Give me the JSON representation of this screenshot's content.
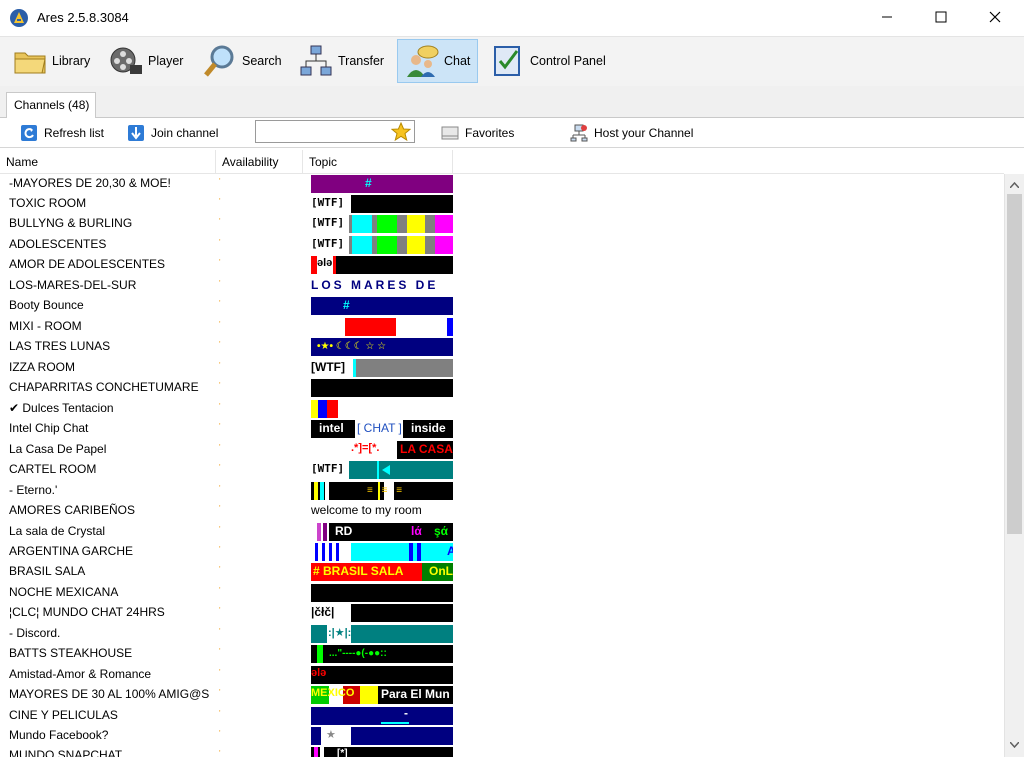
{
  "window": {
    "title": "Ares 2.5.8.3084"
  },
  "toolbar": {
    "items": [
      {
        "label": "Library",
        "icon": "folder-icon"
      },
      {
        "label": "Player",
        "icon": "film-reel-icon"
      },
      {
        "label": "Search",
        "icon": "magnifier-icon"
      },
      {
        "label": "Transfer",
        "icon": "network-transfer-icon"
      },
      {
        "label": "Chat",
        "icon": "chat-users-icon"
      },
      {
        "label": "Control Panel",
        "icon": "control-panel-icon"
      }
    ],
    "active": "Chat"
  },
  "tabs": {
    "channels": "Channels (48)"
  },
  "subbar": {
    "refresh": "Refresh list",
    "join": "Join channel",
    "search_value": "",
    "favorites": "Favorites",
    "host": "Host your Channel"
  },
  "columns": {
    "name": "Name",
    "availability": "Availability",
    "topic": "Topic"
  },
  "channels": [
    {
      "name": "-MAYORES DE 20,30 & MOE!",
      "topic_text": "#"
    },
    {
      "name": "TOXIC ROOM",
      "topic_text": "[WTF]"
    },
    {
      "name": "BULLYNG & BURLING",
      "topic_text": "[WTF]"
    },
    {
      "name": "ADOLESCENTES",
      "topic_text": "[WTF]"
    },
    {
      "name": "AMOR DE ADOLESCENTES",
      "topic_text": "ələ"
    },
    {
      "name": "LOS-MARES-DEL-SUR",
      "topic_text": "LOS MARES DE"
    },
    {
      "name": "Booty Bounce",
      "topic_text": "#"
    },
    {
      "name": "MIXI - ROOM",
      "topic_text": ""
    },
    {
      "name": "LAS TRES LUNAS",
      "topic_text": "•★•  ☾☾☾ ☆ ☆"
    },
    {
      "name": "IZZA ROOM",
      "topic_text": "[WTF]"
    },
    {
      "name": "CHAPARRITAS CONCHETUMARE",
      "topic_text": ""
    },
    {
      "name": "✔ Dulces Tentacion",
      "topic_text": ""
    },
    {
      "name": "Intel Chip Chat",
      "topic_text_a": "intel",
      "topic_text_b": "[ CHAT ]",
      "topic_text_c": "inside"
    },
    {
      "name": "La Casa De Papel",
      "topic_text_a": ".*]=[*.",
      "topic_text_b": "LA CASA"
    },
    {
      "name": "CARTEL ROOM",
      "topic_text": "[WTF]"
    },
    {
      "name": "-    Eterno.'",
      "topic_text": "≡ ≡ ≡"
    },
    {
      "name": "AMORES CARIBEÑOS",
      "topic_text": "welcome to my room"
    },
    {
      "name": "La sala de Crystal",
      "topic_text_a": "RD",
      "topic_text_b": "lά",
      "topic_text_c": "şά"
    },
    {
      "name": "ARGENTINA GARCHE",
      "topic_text": "A"
    },
    {
      "name": "BRASIL SALA",
      "topic_text_a": "# BRASIL  SALA",
      "topic_text_b": "OnL"
    },
    {
      "name": "NOCHE MEXICANA",
      "topic_text": ""
    },
    {
      "name": "¦CLC¦ MUNDO CHAT 24HRS",
      "topic_text": "|čłč|"
    },
    {
      "name": "   - Discord.",
      "topic_text": ":|★|:"
    },
    {
      "name": "BATTS STEAKHOUSE",
      "topic_text": "...\"----●(-●●::"
    },
    {
      "name": "Amistad-Amor & Romance",
      "topic_text": "ələ"
    },
    {
      "name": "MAYORES DE 30 AL 100% AMIG@S",
      "topic_text_a": "MEXICO",
      "topic_text_b": "Para El Mun"
    },
    {
      "name": "CINE Y PELICULAS",
      "topic_text": "-"
    },
    {
      "name": "Mundo Facebook?",
      "topic_text": "★"
    },
    {
      "name": "MUNDO SNAPCHAT",
      "topic_text": "[*]"
    }
  ],
  "colors": {
    "active_tab_bg": "#cce4f7",
    "purple": "#800080",
    "navy": "#000080",
    "teal": "#008080",
    "cyan": "#00ffff",
    "magenta": "#ff00ff",
    "yellow": "#ffff00",
    "red": "#ff0000",
    "lime": "#00ff00",
    "gray": "#808080"
  }
}
